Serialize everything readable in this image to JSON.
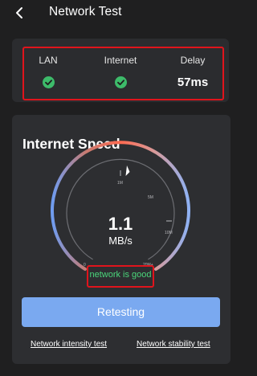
{
  "header": {
    "title": "Network Test"
  },
  "summary": {
    "metrics": [
      {
        "label": "LAN",
        "status": "ok"
      },
      {
        "label": "Internet",
        "status": "ok"
      },
      {
        "label": "Delay",
        "value": "57ms"
      }
    ]
  },
  "speed": {
    "title": "Internet Speed",
    "value": "1.1",
    "unit": "MB/s",
    "status": "network is good",
    "scale_labels": [
      "0",
      "1M",
      "5M",
      "10M",
      "20M+"
    ]
  },
  "actions": {
    "retest_label": "Retesting",
    "link_intensity": "Network intensity test",
    "link_stability": "Network stability test"
  },
  "colors": {
    "background": "#1f1f20",
    "card": "#2d2e31",
    "accent_button": "#7aa9f0",
    "status_good": "#4ad67a",
    "check_ok": "#3dbb6a",
    "highlight_border": "#e0141c"
  }
}
